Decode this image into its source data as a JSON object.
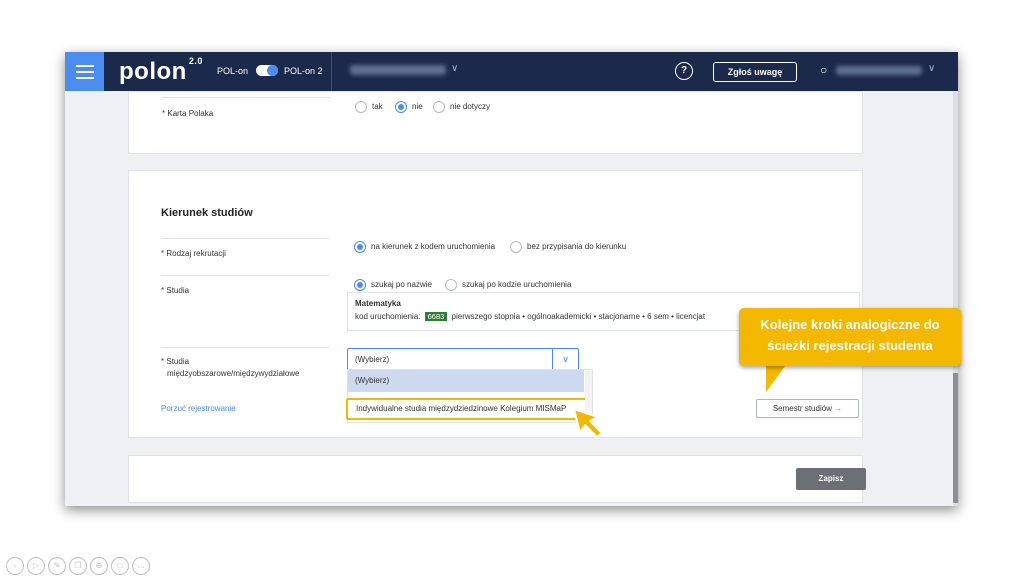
{
  "topbar": {
    "logo": "polon",
    "logo_version": "2.0",
    "pol_on_label": "POL-on",
    "pol_on2_label": "POL-on 2",
    "help_label": "?",
    "report_button": "Zgłoś uwagę"
  },
  "karta_polaka": {
    "label": "Karta Polaka",
    "options": [
      "tak",
      "nie",
      "nie dotyczy"
    ],
    "selected": "nie"
  },
  "kierunek": {
    "heading": "Kierunek studiów",
    "rodzaj_label": "Rodzaj rekrutacji",
    "rodzaj_options": [
      "na kierunek z kodem uruchomienia",
      "bez przypisania do kierunku"
    ],
    "studia_label": "Studia",
    "studia_options": [
      "szukaj po nazwie",
      "szukaj po kodzie uruchomienia"
    ],
    "info_title": "Matematyka",
    "info_code_label": "kod uruchomienia:",
    "info_code": "6683",
    "info_details": "pierwszego stopnia • ogólnoakademicki • stacjonarne • 6 sem • licencjat",
    "miedzy_label_1": "Studia",
    "miedzy_label_2": "międzyobszarowe/międzywydziałowe",
    "select_value": "(Wybierz)",
    "dropdown_options": [
      "(Wybierz)",
      "Indywidualne studia międzydziedzinowe Kolegium MISMaP"
    ]
  },
  "actions": {
    "porzuc": "Porzuć rejestrowanie",
    "semestr": "Semestr studiów",
    "zapisz": "Zapisz"
  },
  "callout": {
    "line1": "Kolejne kroki analogiczne do",
    "line2": "ścieżki rejestracji studenta"
  },
  "icons": {
    "menu": "hamburger-icon",
    "help": "help-circle-icon",
    "user": "user-icon",
    "chevron": "chevron-down-icon",
    "arrow": "arrow-right-icon"
  },
  "colors": {
    "topbar": "#1b2a4a",
    "accent": "#4a8cf0",
    "callout": "#f5b800",
    "code_badge": "#2e7d32"
  }
}
